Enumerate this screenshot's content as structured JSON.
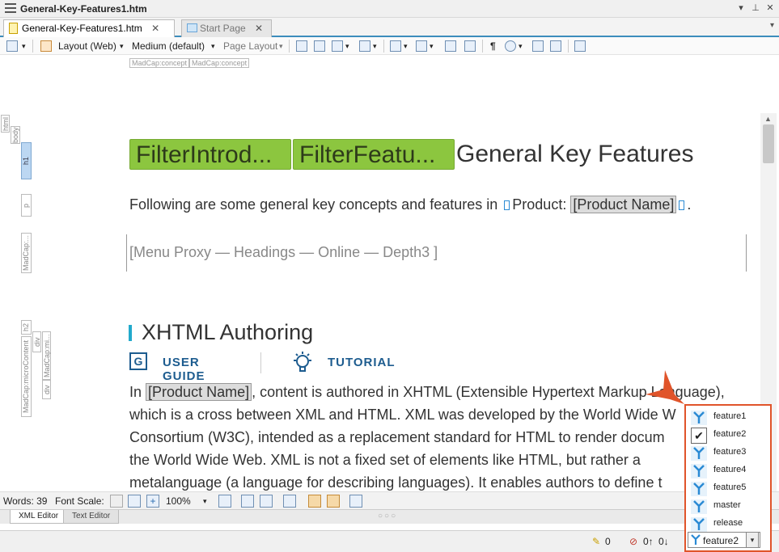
{
  "window": {
    "title": "General-Key-Features1.htm"
  },
  "tabs": [
    {
      "label": "General-Key-Features1.htm",
      "active": true
    },
    {
      "label": "Start Page",
      "active": false
    }
  ],
  "toolbar": {
    "layout": "Layout (Web)",
    "medium": "Medium (default)",
    "page_layout": "Page Layout"
  },
  "concept_tags": [
    "MadCap:concept",
    "MadCap:concept"
  ],
  "structure_bar": [
    "html",
    "body",
    "h1",
    "p",
    "MadCap:...",
    "h2",
    "MadCap:microContent",
    "div",
    "div",
    "MadCap:mi..."
  ],
  "document": {
    "snippets": [
      "FilterIntrod...",
      "FilterFeatu..."
    ],
    "h1": "General Key Features",
    "intro_prefix": "Following are some general key concepts and features in",
    "intro_product": "Product:",
    "intro_var": "[Product Name]",
    "intro_suffix": ".",
    "menu_proxy": "[Menu Proxy — Headings — Online — Depth3 ]",
    "h2": "XHTML Authoring",
    "links": {
      "user_guide": "USER GUIDE",
      "tutorial": "TUTORIAL",
      "guide_icon_letter": "G"
    },
    "body_prefix": "In",
    "body_var": "[Product Name]",
    "body_lines": [
      ", content is authored in XHTML (Extensible Hypertext Markup Language),",
      "which is a cross between XML and HTML. XML was developed by the World Wide W",
      "Consortium (W3C), intended as a replacement standard for HTML to render docum",
      "the World Wide Web. XML is not a fixed set of elements like HTML, but rather a",
      "metalanguage (a language for describing languages). It enables authors to define t"
    ]
  },
  "status": {
    "words": "Words: 39",
    "font_scale": "Font Scale:",
    "zoom": "100%"
  },
  "editor_tabs": [
    "XML Editor",
    "Text Editor"
  ],
  "bottom": {
    "edits": "0",
    "up": "0↑",
    "down": "0↓"
  },
  "target_dropdown": {
    "items": [
      "feature1",
      "feature2",
      "feature3",
      "feature4",
      "feature5",
      "master",
      "release"
    ],
    "checked": "feature2",
    "selected": "feature2"
  },
  "colors": {
    "snippet": "#8cc63f",
    "accent": "#22aacc",
    "link": "#1d5c8f",
    "callout": "#e0542a"
  }
}
